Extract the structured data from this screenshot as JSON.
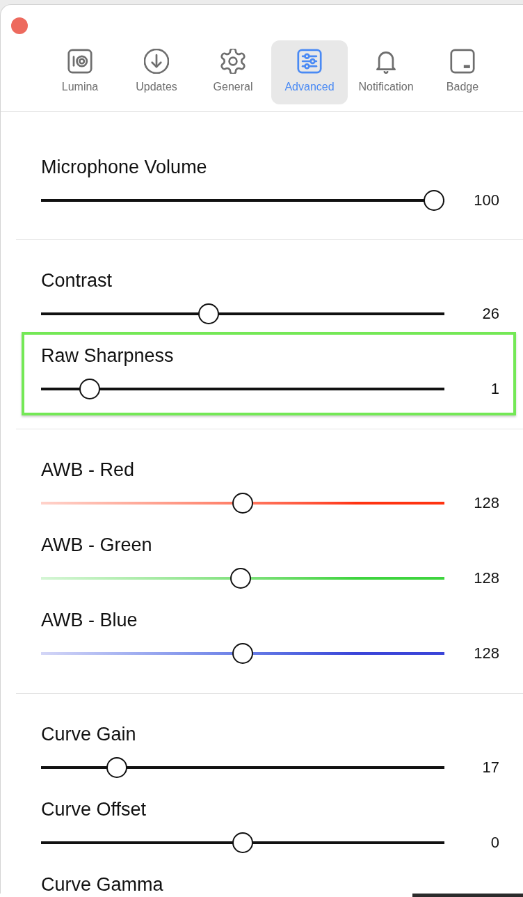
{
  "tabs": [
    {
      "label": "Lumina",
      "selected": false
    },
    {
      "label": "Updates",
      "selected": false
    },
    {
      "label": "General",
      "selected": false
    },
    {
      "label": "Advanced",
      "selected": true
    },
    {
      "label": "Notification",
      "selected": false
    },
    {
      "label": "Badge",
      "selected": false
    }
  ],
  "sections": [
    {
      "sliders": [
        {
          "label": "Microphone Volume",
          "level": 1.0,
          "reading": "100",
          "highlighted": false
        }
      ]
    },
    {
      "sliders": [
        {
          "label": "Contrast",
          "level": 0.41,
          "reading": "26",
          "highlighted": false
        },
        {
          "label": "Raw Sharpness",
          "level": 0.1,
          "reading": "1",
          "highlighted": true
        }
      ]
    },
    {
      "sliders": [
        {
          "label": "AWB - Red",
          "level": 0.5,
          "reading": "128",
          "color": "#ff3311",
          "highlighted": false
        },
        {
          "label": "AWB - Green",
          "level": 0.495,
          "reading": "128",
          "color": "#3ed43e",
          "highlighted": false
        },
        {
          "label": "AWB - Blue",
          "level": 0.5,
          "reading": "128",
          "color": "#3a44d8",
          "highlighted": false
        }
      ]
    },
    {
      "sliders": [
        {
          "label": "Curve Gain",
          "level": 0.17,
          "reading": "17",
          "highlighted": false
        },
        {
          "label": "Curve Offset",
          "level": 0.5,
          "reading": "0",
          "highlighted": false
        },
        {
          "label": "Curve Gamma",
          "highlighted": false
        }
      ]
    }
  ]
}
